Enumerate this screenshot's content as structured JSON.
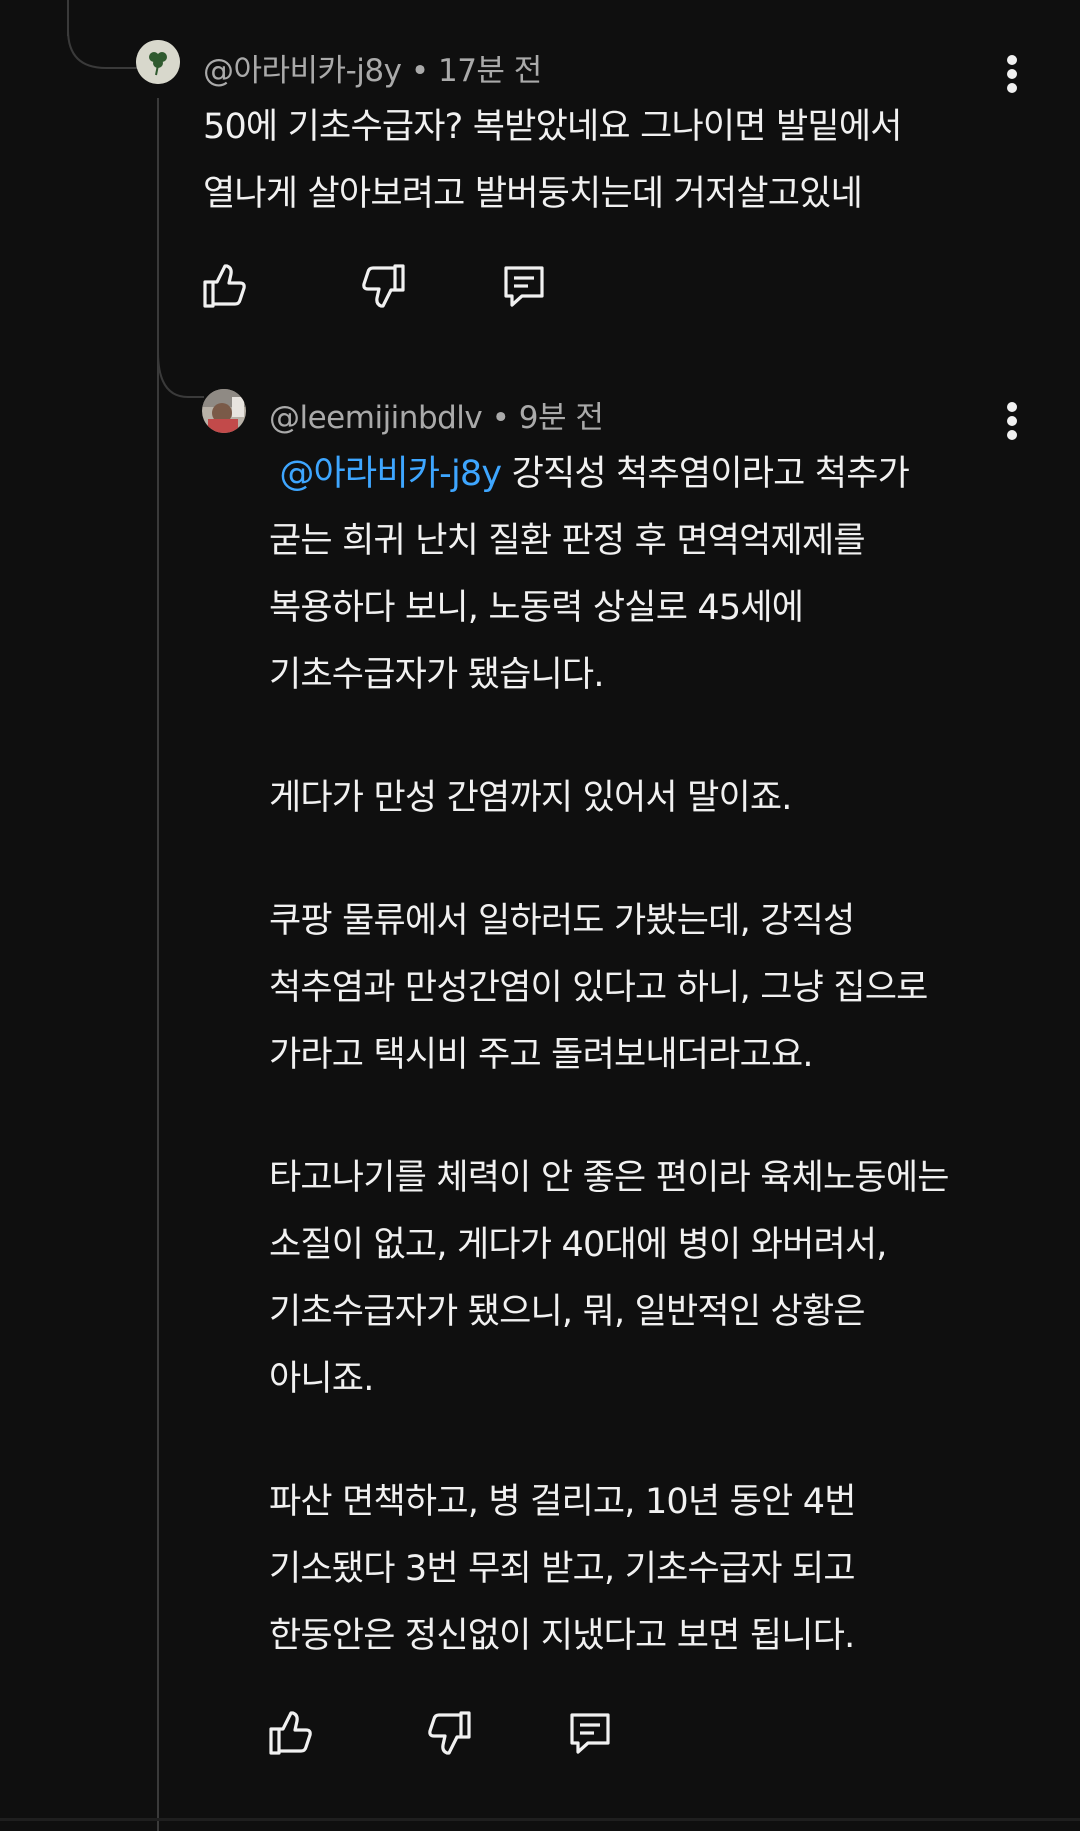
{
  "comment1": {
    "handle": "@아라비카-j8y",
    "meta_sep": "•",
    "time": "17분 전",
    "lines": [
      "50에 기초수급자? 복받았네요  그나이면  발밑에서",
      "열나게 살아보려고 발버둥치는데 거저살고있네"
    ],
    "avatar_icon": "clover-avatar"
  },
  "reply1": {
    "handle": "@leemijinbdlv",
    "meta_sep": "•",
    "time": "9분 전",
    "mention": "@아라비카-j8y",
    "first_line_rest": " 강직성 척추염이라고 척추가",
    "lines": [
      "굳는 희귀 난치 질환 판정 후 면역억제제를",
      "복용하다 보니, 노동력 상실로 45세에",
      "기초수급자가 됐습니다.",
      "",
      "게다가 만성 간염까지 있어서 말이죠.",
      "",
      "쿠팡 물류에서 일하러도 가봤는데, 강직성",
      "척추염과 만성간염이 있다고 하니, 그냥 집으로",
      "가라고 택시비 주고 돌려보내더라고요.",
      "",
      "타고나기를 체력이 안 좋은 편이라 육체노동에는",
      "소질이 없고, 게다가 40대에 병이 와버려서,",
      "기초수급자가 됐으니, 뭐, 일반적인 상황은",
      "아니죠.",
      "",
      "파산 면책하고, 병 걸리고, 10년 동안 4번",
      "기소됐다 3번 무죄 받고, 기초수급자 되고",
      "한동안은 정신없이 지냈다고 보면 됩니다."
    ]
  },
  "icons": {
    "like": "thumbs-up-icon",
    "dislike": "thumbs-down-icon",
    "reply": "reply-comment-icon",
    "more": "more-vert-icon"
  },
  "colors": {
    "background": "#0f0f0f",
    "text": "#f1f1f1",
    "meta": "#aaaaaa",
    "mention": "#3ea6ff",
    "thread_line": "#3a3a3a"
  }
}
